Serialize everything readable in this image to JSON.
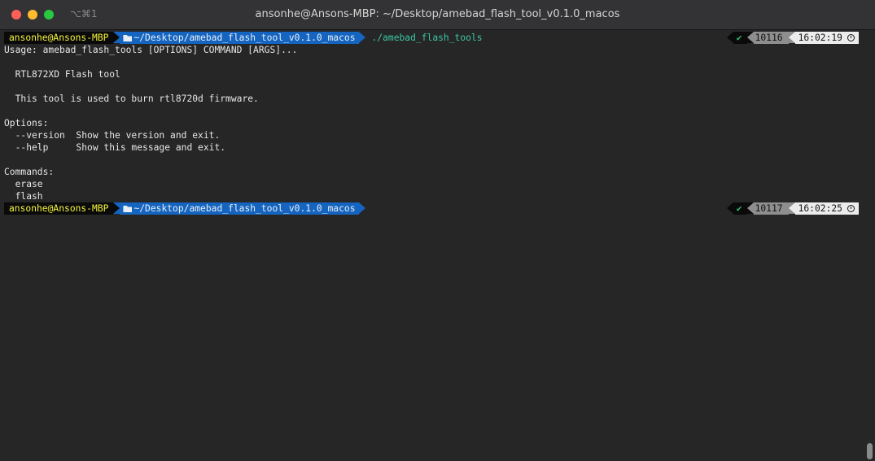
{
  "window": {
    "shortcut": "⌥⌘1",
    "title": "ansonhe@Ansons-MBP: ~/Desktop/amebad_flash_tool_v0.1.0_macos"
  },
  "prompts": [
    {
      "user": "ansonhe@Ansons-MBP",
      "path": "~/Desktop/amebad_flash_tool_v0.1.0_macos",
      "command": "./amebad_flash_tools",
      "status_icon": "check-icon",
      "status": "✔",
      "history": "10116",
      "time": "16:02:19"
    },
    {
      "user": "ansonhe@Ansons-MBP",
      "path": "~/Desktop/amebad_flash_tool_v0.1.0_macos",
      "command": "",
      "status_icon": "check-icon",
      "status": "✔",
      "history": "10117",
      "time": "16:02:25"
    }
  ],
  "output": [
    "Usage: amebad_flash_tools [OPTIONS] COMMAND [ARGS]...",
    "",
    "  RTL872XD Flash tool",
    "",
    "  This tool is used to burn rtl8720d firmware.",
    "",
    "Options:",
    "  --version  Show the version and exit.",
    "  --help     Show this message and exit.",
    "",
    "Commands:",
    "  erase",
    "  flash"
  ],
  "colors": {
    "user_fg": "#f5f53b",
    "path_bg": "#1565c0",
    "command_fg": "#3cc7a6",
    "ok_fg": "#2fbf71"
  }
}
